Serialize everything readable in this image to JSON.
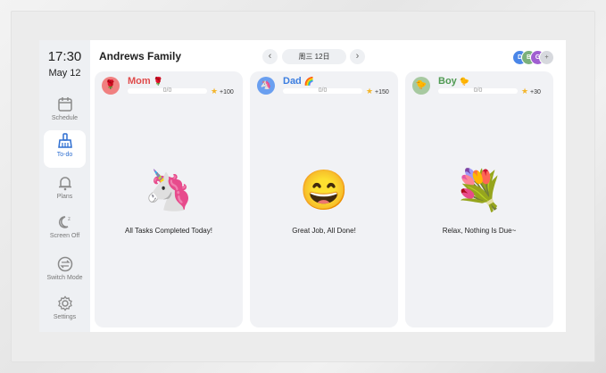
{
  "sidebar": {
    "time": "17:30",
    "date": "May 12",
    "items": [
      {
        "label": "Schedule",
        "icon": "calendar-icon",
        "active": false
      },
      {
        "label": "To-do",
        "icon": "broom-icon",
        "active": true
      },
      {
        "label": "Plans",
        "icon": "bell-icon",
        "active": false
      },
      {
        "label": "Screen Off",
        "icon": "moon-icon",
        "active": false
      },
      {
        "label": "Switch Mode",
        "icon": "switch-icon",
        "active": false
      },
      {
        "label": "Settings",
        "icon": "gear-icon",
        "active": false
      }
    ]
  },
  "header": {
    "title": "Andrews Family",
    "prev_icon": "chevron-left-icon",
    "next_icon": "chevron-right-icon",
    "date_label": "周三 12日",
    "avatars": [
      {
        "letter": "D",
        "color": "#4a86e8"
      },
      {
        "letter": "B",
        "color": "#7bb07b"
      },
      {
        "letter": "G",
        "color": "#a05fd1"
      }
    ],
    "add_label": "+"
  },
  "members": [
    {
      "name": "Mom",
      "name_emoji": "🌹",
      "avatar_emoji": "🌹",
      "color": "#e04b4b",
      "avatar_bg": "#f08080",
      "progress_text": "0/0",
      "progress": 0,
      "points": "+100",
      "big_emoji": "🦄",
      "message": "All Tasks Completed Today!"
    },
    {
      "name": "Dad",
      "name_emoji": "🌈",
      "avatar_emoji": "🦄",
      "color": "#3b7de0",
      "avatar_bg": "#6a9ff0",
      "progress_text": "0/0",
      "progress": 0,
      "points": "+150",
      "big_emoji": "😄",
      "message": "Great Job, All Done!"
    },
    {
      "name": "Boy",
      "name_emoji": "🐤",
      "avatar_emoji": "🐤",
      "color": "#4f9a52",
      "avatar_bg": "#a7c9a0",
      "progress_text": "0/0",
      "progress": 0,
      "points": "+30",
      "big_emoji": "💐",
      "message": "Relax, Nothing Is Due~"
    }
  ]
}
